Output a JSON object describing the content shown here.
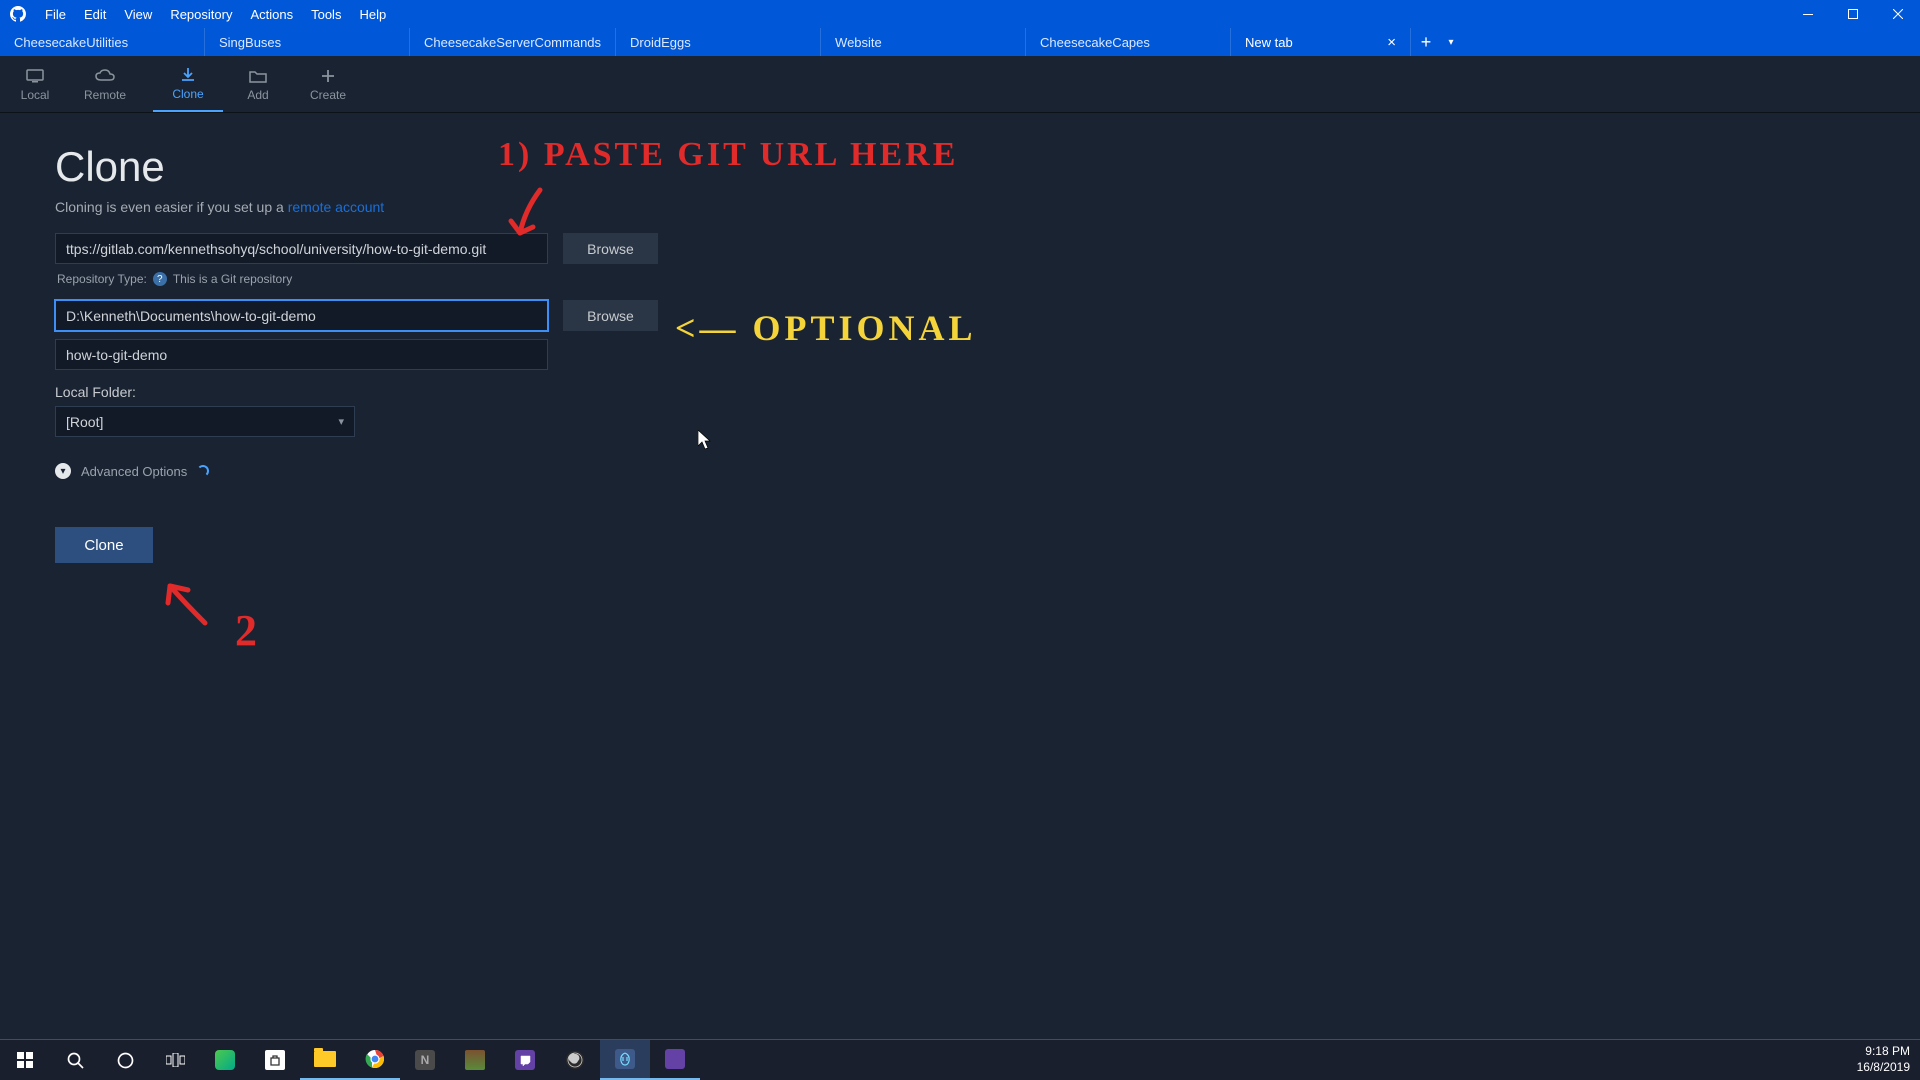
{
  "menu": {
    "file": "File",
    "edit": "Edit",
    "view": "View",
    "repository": "Repository",
    "actions": "Actions",
    "tools": "Tools",
    "help": "Help"
  },
  "tabs": [
    "CheesecakeUtilities",
    "SingBuses",
    "CheesecakeServerCommands",
    "DroidEggs",
    "Website",
    "CheesecakeCapes"
  ],
  "new_tab_label": "New tab",
  "toolbar": {
    "local": "Local",
    "remote": "Remote",
    "clone": "Clone",
    "add": "Add",
    "create": "Create"
  },
  "page": {
    "title": "Clone",
    "subtitle_prefix": "Cloning is even easier if you set up a ",
    "subtitle_link": "remote account",
    "url_value": "ttps://gitlab.com/kennethsohyq/school/university/how-to-git-demo.git",
    "repo_type_label": "Repository Type:",
    "repo_type_value": "This is a Git repository",
    "dest_value": "D:\\Kenneth\\Documents\\how-to-git-demo",
    "name_value": "how-to-git-demo",
    "local_folder_label": "Local Folder:",
    "local_folder_value": "[Root]",
    "advanced": "Advanced Options",
    "browse": "Browse",
    "clone_button": "Clone"
  },
  "annotations": {
    "step1": "1) PASTE GIT URL HERE",
    "optional": "<— OPTIONAL",
    "step2": "2"
  },
  "clock": {
    "time": "9:18 PM",
    "date": "16/8/2019"
  }
}
